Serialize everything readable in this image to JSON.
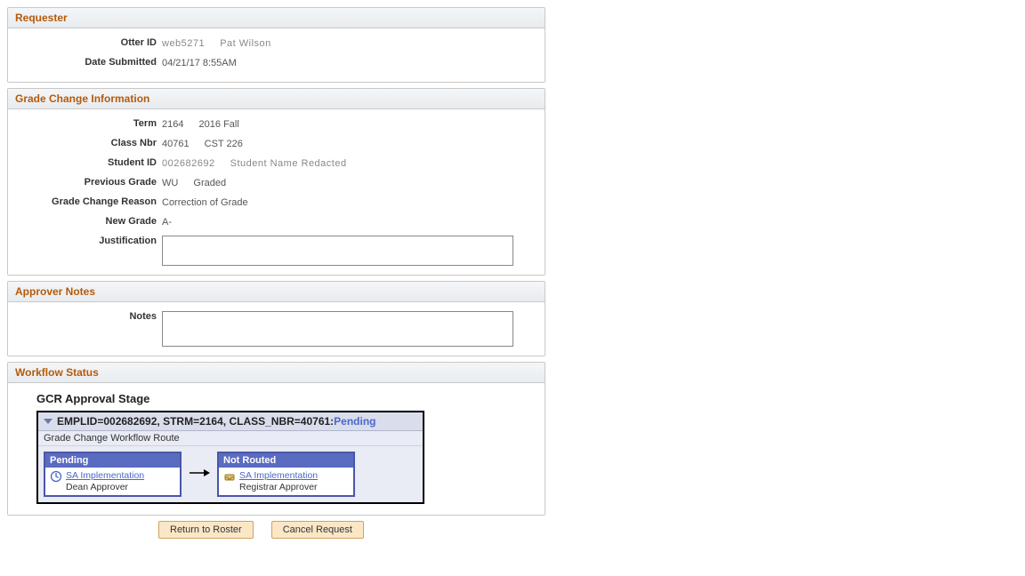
{
  "requester": {
    "title": "Requester",
    "otter_id_label": "Otter ID",
    "otter_id_value": "web5271",
    "otter_id_name": "Pat Wilson",
    "date_label": "Date Submitted",
    "date_value": "04/21/17  8:55AM"
  },
  "gci": {
    "title": "Grade Change Information",
    "term_label": "Term",
    "term_code": "2164",
    "term_desc": "2016 Fall",
    "classnbr_label": "Class Nbr",
    "classnbr_value": "40761",
    "classnbr_desc": "CST 226",
    "student_label": "Student ID",
    "student_id": "002682692",
    "student_name": "Student Name Redacted",
    "prevgrade_label": "Previous Grade",
    "prevgrade_value": "WU",
    "prevgrade_basis": "Graded",
    "reason_label": "Grade Change Reason",
    "reason_value": "Correction of Grade",
    "newgrade_label": "New Grade",
    "newgrade_value": "A-",
    "justification_label": "Justification",
    "justification_value": ""
  },
  "approver": {
    "title": "Approver Notes",
    "notes_label": "Notes",
    "notes_value": ""
  },
  "workflow": {
    "title": "Workflow Status",
    "stage_title": "GCR Approval Stage",
    "header_text": "EMPLID=002682692, STRM=2164, CLASS_NBR=40761:",
    "header_status": "Pending",
    "route_title": "Grade Change Workflow Route",
    "steps": [
      {
        "status": "Pending",
        "link": "SA Implementation",
        "role": "Dean Approver"
      },
      {
        "status": "Not Routed",
        "link": "SA Implementation",
        "role": "Registrar Approver"
      }
    ]
  },
  "buttons": {
    "return": "Return to Roster",
    "cancel": "Cancel Request"
  }
}
